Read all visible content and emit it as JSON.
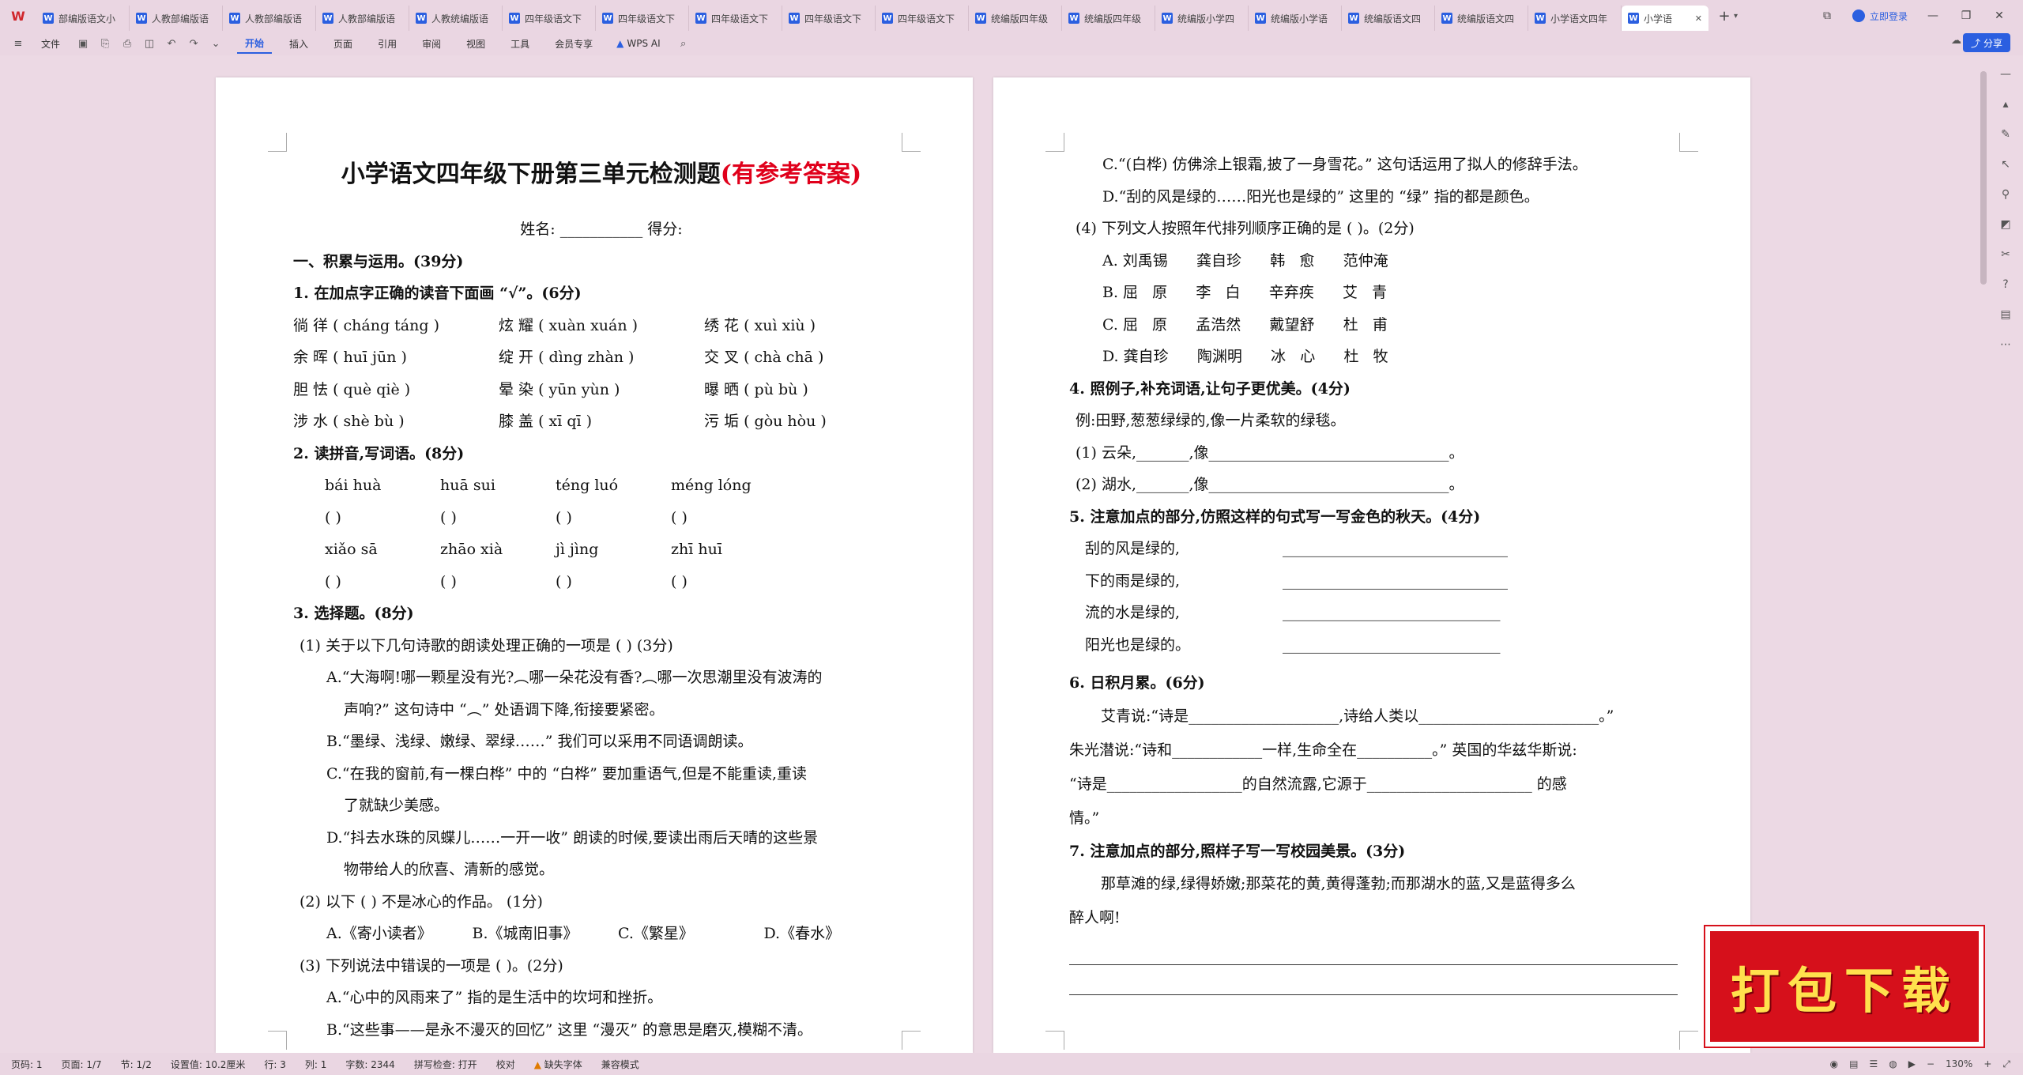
{
  "tabbar": {
    "tabs": [
      "部编版语文小",
      "人教部编版语",
      "人教部编版语",
      "人教部编版语",
      "人教统编版语",
      "四年级语文下",
      "四年级语文下",
      "四年级语文下",
      "四年级语文下",
      "四年级语文下",
      "统编版四年级",
      "统编版四年级",
      "统编版小学四",
      "统编版小学语",
      "统编版语文四",
      "统编版语文四",
      "小学语文四年"
    ],
    "active_tab": "小学语",
    "login": "立即登录"
  },
  "toolbar": {
    "file": "文件",
    "menus": [
      "开始",
      "插入",
      "页面",
      "引用",
      "审阅",
      "视图",
      "工具",
      "会员专享"
    ],
    "wps_ai": "WPS AI",
    "share": "分享"
  },
  "page1": {
    "title_main": "小学语文四年级下册第三单元检测题",
    "title_red": "(有参考答案)",
    "name_line": "姓名: ___________      得分:",
    "sec1": "一、积累与运用。(39分)",
    "q1": "1. 在加点字正确的读音下面画 “√”。(6分)",
    "q1_rows": [
      [
        "徜 徉 ( cháng   táng )",
        "炫 耀 ( xuàn   xuán )",
        "绣 花 ( xuì    xiù )"
      ],
      [
        "余 晖 ( huī     jūn )",
        "绽 开 ( dìng   zhàn )",
        "交 叉 ( chà    chā )"
      ],
      [
        "胆 怯 ( què     qiè )",
        "晕 染 ( yūn    yùn )",
        "曝 晒 ( pù     bù )"
      ],
      [
        "涉 水 ( shè     bù )",
        "膝 盖 ( xī     qī )",
        "污 垢 ( gòu    hòu )"
      ]
    ],
    "q2": "2. 读拼音,写词语。(8分)",
    "q2_pinyin_1": [
      "bái  huà",
      "huā  sui",
      "téng  luó",
      "méng  lóng"
    ],
    "q2_pinyin_2": [
      "xiǎo  sā",
      "zhāo  xià",
      "jì  jìng",
      "zhī  huī"
    ],
    "q2_brackets": [
      "(          )",
      "(          )",
      "(          )",
      "(          )"
    ],
    "q3": "3. 选择题。(8分)",
    "q3_1": "(1) 关于以下几句诗歌的朗读处理正确的一项是 (        ) (3分)",
    "q3_1_a": "A.“大海啊!哪一颗星没有光?︵哪一朵花没有香?︵哪一次思潮里没有波涛的",
    "q3_1_a2": "声响?” 这句诗中 “︵” 处语调下降,衔接要紧密。",
    "q3_1_b": "B.“墨绿、浅绿、嫩绿、翠绿……” 我们可以采用不同语调朗读。",
    "q3_1_c": "C.“在我的窗前,有一棵白桦” 中的 “白桦” 要加重语气,但是不能重读,重读",
    "q3_1_c2": "了就缺少美感。",
    "q3_1_d": "D.“抖去水珠的凤蝶儿……一开一收” 朗读的时候,要读出雨后天晴的这些景",
    "q3_1_d2": "物带给人的欣喜、清新的感觉。",
    "q3_2": "(2) 以下 (    ) 不是冰心的作品。 (1分)",
    "q3_2_opts": [
      "A.《寄小读者》",
      "B.《城南旧事》",
      "C.《繁星》",
      "D.《春水》"
    ],
    "q3_3": "(3) 下列说法中错误的一项是 (      )。(2分)",
    "q3_3_a": "A.“心中的风雨来了” 指的是生活中的坎坷和挫折。",
    "q3_3_b": "B.“这些事——是永不漫灭的回忆” 这里 “漫灭” 的意思是磨灭,模糊不清。"
  },
  "page2": {
    "q3_3_c": "C.“(白桦) 仿佛涂上银霜,披了一身雪花。” 这句话运用了拟人的修辞手法。",
    "q3_3_d": "D.“刮的风是绿的……阳光也是绿的” 这里的 “绿” 指的都是颜色。",
    "q3_4": "(4) 下列文人按照年代排列顺序正确的是 (        )。(2分)",
    "q3_4_opts": [
      "A. 刘禹锡      龚自珍      韩   愈      范仲淹",
      "B. 屈   原      李   白      辛弃疾      艾   青",
      "C. 屈   原      孟浩然      戴望舒      杜   甫",
      "D. 龚自珍      陶渊明      冰   心      杜   牧"
    ],
    "q4": "4. 照例子,补充词语,让句子更优美。(4分)",
    "q4_example": "例:田野,葱葱绿绿的,像一片柔软的绿毯。",
    "q4_1": "(1) 云朵,_______,像________________________________。",
    "q4_2": "(2) 湖水,_______,像________________________________。",
    "q5": "5. 注意加点的部分,仿照这样的句式写一写金色的秋天。(4分)",
    "q5_lines": [
      "刮的风是绿的,",
      "下的雨是绿的,",
      "流的水是绿的,",
      "阳光也是绿的。"
    ],
    "q5_blanks": [
      "______________________________",
      "______________________________",
      "_____________________________",
      "_____________________________"
    ],
    "q6": "6. 日积月累。(6分)",
    "q6_l1": "艾青说:“诗是____________________,诗给人类以________________________。”",
    "q6_l2": "朱光潜说:“诗和____________一样,生命全在__________。” 英国的华兹华斯说:",
    "q6_l3": "“诗是__________________的自然流露,它源于______________________  的感",
    "q6_l4": "情。”",
    "q7": "7. 注意加点的部分,照样子写一写校园美景。(3分)",
    "q7_l1": "那草滩的绿,绿得娇嫩;那菜花的黄,黄得蓬勃;而那湖水的蓝,又是蓝得多么",
    "q7_l2": "醉人啊!"
  },
  "badge": "打包下载",
  "status": {
    "page": "页码: 1",
    "pages": "页面: 1/7",
    "section": "节: 1/2",
    "setting": "设置值: 10.2厘米",
    "line": "行: 3",
    "column": "列: 1",
    "words": "字数: 2344",
    "spell": "拼写检查: 打开",
    "proof": "校对",
    "missing_font": "缺失字体",
    "compat": "兼容模式",
    "zoom": "130%"
  }
}
